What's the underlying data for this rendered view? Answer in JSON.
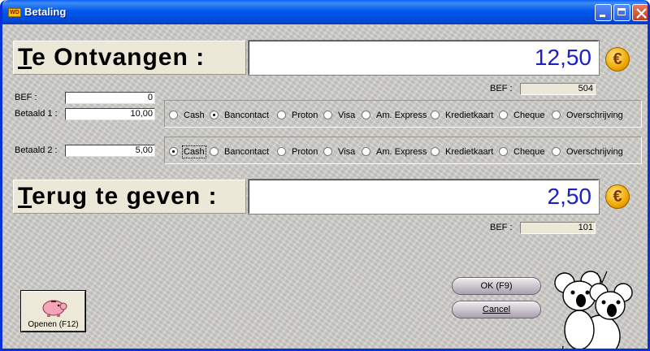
{
  "window": {
    "title": "Betaling",
    "app_icon": "WD"
  },
  "receive": {
    "label_prefix": "T",
    "label_rest": "e Ontvangen :",
    "value": "12,50",
    "bef_label": "BEF :",
    "bef_value": "504"
  },
  "payment": {
    "bef_label": "BEF :",
    "bef_value": "0",
    "paid1_label": "Betaald 1 :",
    "paid1_value": "10,00",
    "paid2_label": "Betaald 2 :",
    "paid2_value": "5,00",
    "methods": [
      "Cash",
      "Bancontact",
      "Proton",
      "Visa",
      "Am. Express",
      "Kredietkaart",
      "Cheque",
      "Overschrijving"
    ],
    "paid1_selected": "Bancontact",
    "paid2_selected": "Cash"
  },
  "change": {
    "label_prefix": "T",
    "label_rest": "erug te geven :",
    "value": "2,50",
    "bef_label": "BEF :",
    "bef_value": "101"
  },
  "buttons": {
    "ok": "OK (F9)",
    "cancel": "Cancel",
    "open": "Openen (F12)"
  },
  "icons": {
    "euro": "euro-coin-icon",
    "piggy": "piggy-bank-icon",
    "koala": "koala-mascot"
  },
  "colors": {
    "titlebar": "#0058ee",
    "amount": "#1c20c8"
  }
}
